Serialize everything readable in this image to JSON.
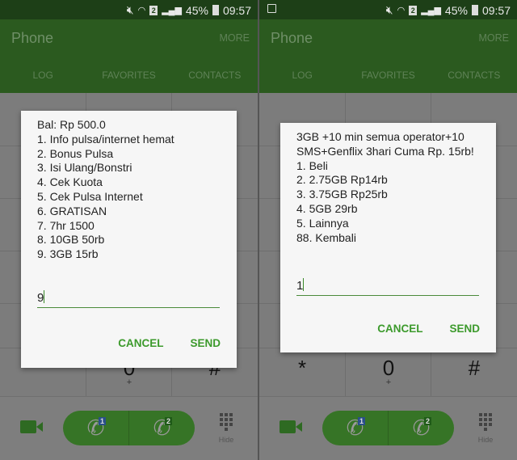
{
  "panels": [
    {
      "status": {
        "battery": "45%",
        "time": "09:57",
        "sim": "2",
        "extra_notification_icon": false
      },
      "header": {
        "title": "Phone",
        "more": "MORE",
        "tabs": [
          "LOG",
          "FAVORITES",
          "CONTACTS"
        ]
      },
      "keypad": {
        "star": "*",
        "zero": "0",
        "zero_sub": "+",
        "hash": "#"
      },
      "bottom": {
        "sim1": "1",
        "sim2": "2",
        "hide": "Hide"
      },
      "dialog": {
        "lines": [
          "Bal: Rp 500.0",
          "1. Info pulsa/internet hemat",
          "2. Bonus Pulsa",
          "3. Isi Ulang/Bonstri",
          "4. Cek Kuota",
          "5. Cek Pulsa Internet",
          "6. GRATISAN",
          "7. 7hr 1500",
          "8. 10GB 50rb",
          "9. 3GB 15rb"
        ],
        "input": "9",
        "cancel": "CANCEL",
        "send": "SEND"
      }
    },
    {
      "status": {
        "battery": "45%",
        "time": "09:57",
        "sim": "2",
        "extra_notification_icon": true
      },
      "header": {
        "title": "Phone",
        "more": "MORE",
        "tabs": [
          "LOG",
          "FAVORITES",
          "CONTACTS"
        ]
      },
      "keypad": {
        "star": "*",
        "zero": "0",
        "zero_sub": "+",
        "hash": "#"
      },
      "bottom": {
        "sim1": "1",
        "sim2": "2",
        "hide": "Hide"
      },
      "dialog": {
        "lines": [
          "3GB +10 min semua operator+10",
          "SMS+Genflix 3hari Cuma Rp. 15rb!",
          "1. Beli",
          "2. 2.75GB Rp14rb",
          "3. 3.75GB Rp25rb",
          "4. 5GB 29rb",
          "5. Lainnya",
          "88. Kembali"
        ],
        "input": "1",
        "cancel": "CANCEL",
        "send": "SEND"
      }
    }
  ],
  "colors": {
    "accent": "#3c9a2c",
    "header": "#2b5a1f",
    "status_bar": "#1d3f17"
  }
}
